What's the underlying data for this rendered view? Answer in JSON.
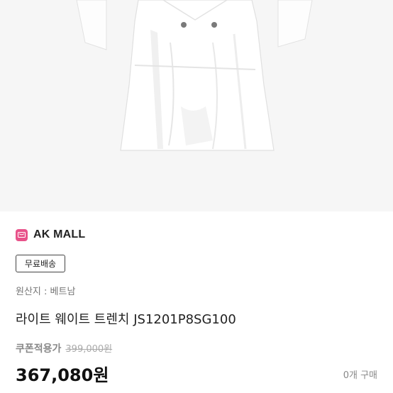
{
  "product": {
    "brand": "AK MALL",
    "badge": "무료배송",
    "origin": "원산지 : 베트남",
    "title": "라이트 웨이트 트렌치 JS1201P8SG100",
    "coupon_label": "쿠폰적용가",
    "original_price": "399,000원",
    "sale_price": "367,080원",
    "purchase_count": "0개 구매"
  },
  "colors": {
    "brand_logo": "#e8528a",
    "photo_background": "#f6f6f6"
  }
}
